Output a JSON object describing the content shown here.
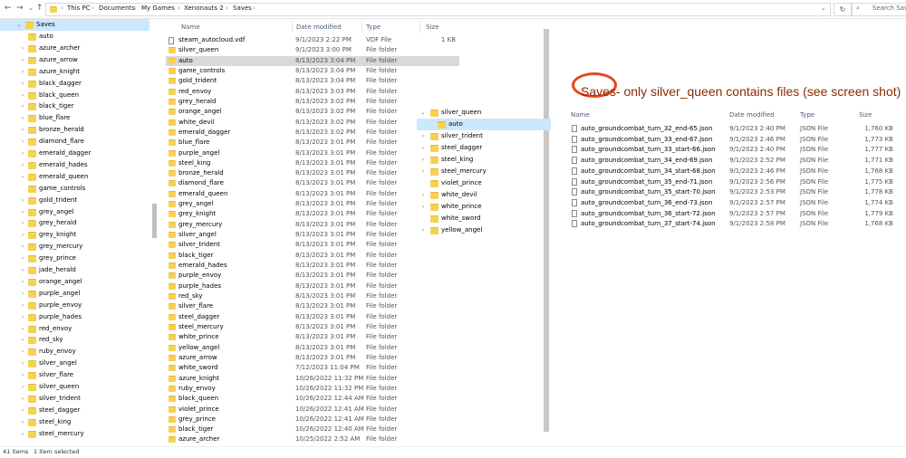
{
  "address_bar": {
    "crumbs": [
      "This PC",
      "Documents",
      "My Games",
      "Xenonauts 2",
      "Saves"
    ],
    "search_placeholder": "Search Saves"
  },
  "tree": {
    "selected": "Saves",
    "items": [
      "auto",
      "azure_archer",
      "azure_arrow",
      "azure_knight",
      "black_dagger",
      "black_queen",
      "black_tiger",
      "blue_flare",
      "bronze_herald",
      "diamond_flare",
      "emerald_dagger",
      "emerald_hades",
      "emerald_queen",
      "game_controls",
      "gold_trident",
      "grey_angel",
      "grey_herald",
      "grey_knight",
      "grey_mercury",
      "grey_prince",
      "jade_herald",
      "orange_angel",
      "purple_angel",
      "purple_envoy",
      "purple_hades",
      "red_envoy",
      "red_sky",
      "ruby_envoy",
      "silver_angel",
      "silver_flare",
      "silver_queen",
      "silver_trident",
      "steel_dagger",
      "steel_king",
      "steel_mercury"
    ]
  },
  "columns": {
    "name": "Name",
    "date": "Date modified",
    "type": "Type",
    "size": "Size"
  },
  "files": [
    {
      "name": "steam_autocloud.vdf",
      "date": "9/1/2023 2:22 PM",
      "type": "VDF File",
      "size": "1 KB",
      "kind": "file"
    },
    {
      "name": "silver_queen",
      "date": "9/1/2023 3:00 PM",
      "type": "File folder",
      "size": "",
      "kind": "folder"
    },
    {
      "name": "auto",
      "date": "8/13/2023 3:04 PM",
      "type": "File folder",
      "size": "",
      "kind": "folder",
      "selected": true
    },
    {
      "name": "game_controls",
      "date": "8/13/2023 3:04 PM",
      "type": "File folder",
      "size": "",
      "kind": "folder"
    },
    {
      "name": "gold_trident",
      "date": "8/13/2023 3:04 PM",
      "type": "File folder",
      "size": "",
      "kind": "folder"
    },
    {
      "name": "red_envoy",
      "date": "8/13/2023 3:03 PM",
      "type": "File folder",
      "size": "",
      "kind": "folder"
    },
    {
      "name": "grey_herald",
      "date": "8/13/2023 3:02 PM",
      "type": "File folder",
      "size": "",
      "kind": "folder"
    },
    {
      "name": "orange_angel",
      "date": "8/13/2023 3:02 PM",
      "type": "File folder",
      "size": "",
      "kind": "folder"
    },
    {
      "name": "white_devil",
      "date": "8/13/2023 3:02 PM",
      "type": "File folder",
      "size": "",
      "kind": "folder"
    },
    {
      "name": "emerald_dagger",
      "date": "8/13/2023 3:02 PM",
      "type": "File folder",
      "size": "",
      "kind": "folder"
    },
    {
      "name": "blue_flare",
      "date": "8/13/2023 3:01 PM",
      "type": "File folder",
      "size": "",
      "kind": "folder"
    },
    {
      "name": "purple_angel",
      "date": "8/13/2023 3:01 PM",
      "type": "File folder",
      "size": "",
      "kind": "folder"
    },
    {
      "name": "steel_king",
      "date": "8/13/2023 3:01 PM",
      "type": "File folder",
      "size": "",
      "kind": "folder"
    },
    {
      "name": "bronze_herald",
      "date": "8/13/2023 3:01 PM",
      "type": "File folder",
      "size": "",
      "kind": "folder"
    },
    {
      "name": "diamond_flare",
      "date": "8/13/2023 3:01 PM",
      "type": "File folder",
      "size": "",
      "kind": "folder"
    },
    {
      "name": "emerald_queen",
      "date": "8/13/2023 3:01 PM",
      "type": "File folder",
      "size": "",
      "kind": "folder"
    },
    {
      "name": "grey_angel",
      "date": "8/13/2023 3:01 PM",
      "type": "File folder",
      "size": "",
      "kind": "folder"
    },
    {
      "name": "grey_knight",
      "date": "8/13/2023 3:01 PM",
      "type": "File folder",
      "size": "",
      "kind": "folder"
    },
    {
      "name": "grey_mercury",
      "date": "8/13/2023 3:01 PM",
      "type": "File folder",
      "size": "",
      "kind": "folder"
    },
    {
      "name": "silver_angel",
      "date": "8/13/2023 3:01 PM",
      "type": "File folder",
      "size": "",
      "kind": "folder"
    },
    {
      "name": "silver_trident",
      "date": "8/13/2023 3:01 PM",
      "type": "File folder",
      "size": "",
      "kind": "folder"
    },
    {
      "name": "black_tiger",
      "date": "8/13/2023 3:01 PM",
      "type": "File folder",
      "size": "",
      "kind": "folder"
    },
    {
      "name": "emerald_hades",
      "date": "8/13/2023 3:01 PM",
      "type": "File folder",
      "size": "",
      "kind": "folder"
    },
    {
      "name": "purple_envoy",
      "date": "8/13/2023 3:01 PM",
      "type": "File folder",
      "size": "",
      "kind": "folder"
    },
    {
      "name": "purple_hades",
      "date": "8/13/2023 3:01 PM",
      "type": "File folder",
      "size": "",
      "kind": "folder"
    },
    {
      "name": "red_sky",
      "date": "8/13/2023 3:01 PM",
      "type": "File folder",
      "size": "",
      "kind": "folder"
    },
    {
      "name": "silver_flare",
      "date": "8/13/2023 3:01 PM",
      "type": "File folder",
      "size": "",
      "kind": "folder"
    },
    {
      "name": "steel_dagger",
      "date": "8/13/2023 3:01 PM",
      "type": "File folder",
      "size": "",
      "kind": "folder"
    },
    {
      "name": "steel_mercury",
      "date": "8/13/2023 3:01 PM",
      "type": "File folder",
      "size": "",
      "kind": "folder"
    },
    {
      "name": "white_prince",
      "date": "8/13/2023 3:01 PM",
      "type": "File folder",
      "size": "",
      "kind": "folder"
    },
    {
      "name": "yellow_angel",
      "date": "8/13/2023 3:01 PM",
      "type": "File folder",
      "size": "",
      "kind": "folder"
    },
    {
      "name": "azure_arrow",
      "date": "8/13/2023 3:01 PM",
      "type": "File folder",
      "size": "",
      "kind": "folder"
    },
    {
      "name": "white_sword",
      "date": "7/12/2023 11:04 PM",
      "type": "File folder",
      "size": "",
      "kind": "folder"
    },
    {
      "name": "azure_knight",
      "date": "10/26/2022 11:32 PM",
      "type": "File folder",
      "size": "",
      "kind": "folder"
    },
    {
      "name": "ruby_envoy",
      "date": "10/26/2022 11:32 PM",
      "type": "File folder",
      "size": "",
      "kind": "folder"
    },
    {
      "name": "black_queen",
      "date": "10/26/2022 12:44 AM",
      "type": "File folder",
      "size": "",
      "kind": "folder"
    },
    {
      "name": "violet_prince",
      "date": "10/26/2022 12:41 AM",
      "type": "File folder",
      "size": "",
      "kind": "folder"
    },
    {
      "name": "grey_prince",
      "date": "10/26/2022 12:41 AM",
      "type": "File folder",
      "size": "",
      "kind": "folder"
    },
    {
      "name": "black_tiger",
      "date": "10/26/2022 12:40 AM",
      "type": "File folder",
      "size": "",
      "kind": "folder"
    },
    {
      "name": "azure_archer",
      "date": "10/25/2022 2:52 AM",
      "type": "File folder",
      "size": "",
      "kind": "folder"
    }
  ],
  "status": {
    "count": "41 items",
    "selected": "1 item selected"
  },
  "inset_tree": [
    {
      "label": "silver_queen",
      "expanded": true,
      "indent": 0
    },
    {
      "label": "auto",
      "expanded": false,
      "indent": 1,
      "selected": true
    },
    {
      "label": "silver_trident",
      "expanded": false,
      "indent": 0
    },
    {
      "label": "steel_dagger",
      "expanded": false,
      "indent": 0
    },
    {
      "label": "steel_king",
      "expanded": false,
      "indent": 0
    },
    {
      "label": "steel_mercury",
      "expanded": false,
      "indent": 0
    },
    {
      "label": "violet_prince",
      "expanded": false,
      "indent": 0,
      "nochev": true
    },
    {
      "label": "white_devil",
      "expanded": false,
      "indent": 0
    },
    {
      "label": "white_prince",
      "expanded": false,
      "indent": 0
    },
    {
      "label": "white_sword",
      "expanded": false,
      "indent": 0,
      "nochev": true
    },
    {
      "label": "yellow_angel",
      "expanded": false,
      "indent": 0
    }
  ],
  "note": "Saves- only silver_queen contains files (see screen shot)",
  "right_pane": {
    "columns": {
      "name": "Name",
      "date": "Date modified",
      "type": "Type",
      "size": "Size"
    },
    "files": [
      {
        "name": "auto_groundcombat_turn_32_end-65.json",
        "date": "9/1/2023 2:40 PM",
        "type": "JSON File",
        "size": "1,760 KB"
      },
      {
        "name": "auto_groundcombat_turn_33_end-67.json",
        "date": "9/1/2023 2:46 PM",
        "type": "JSON File",
        "size": "1,773 KB"
      },
      {
        "name": "auto_groundcombat_turn_33_start-66.json",
        "date": "9/1/2023 2:40 PM",
        "type": "JSON File",
        "size": "1,777 KB"
      },
      {
        "name": "auto_groundcombat_turn_34_end-69.json",
        "date": "9/1/2023 2:52 PM",
        "type": "JSON File",
        "size": "1,771 KB"
      },
      {
        "name": "auto_groundcombat_turn_34_start-68.json",
        "date": "9/1/2023 2:46 PM",
        "type": "JSON File",
        "size": "1,768 KB"
      },
      {
        "name": "auto_groundcombat_turn_35_end-71.json",
        "date": "9/1/2023 2:56 PM",
        "type": "JSON File",
        "size": "1,775 KB"
      },
      {
        "name": "auto_groundcombat_turn_35_start-70.json",
        "date": "9/1/2023 2:53 PM",
        "type": "JSON File",
        "size": "1,778 KB"
      },
      {
        "name": "auto_groundcombat_turn_36_end-73.json",
        "date": "9/1/2023 2:57 PM",
        "type": "JSON File",
        "size": "1,774 KB"
      },
      {
        "name": "auto_groundcombat_turn_36_start-72.json",
        "date": "9/1/2023 2:57 PM",
        "type": "JSON File",
        "size": "1,779 KB"
      },
      {
        "name": "auto_groundcombat_turn_37_start-74.json",
        "date": "9/1/2023 2:58 PM",
        "type": "JSON File",
        "size": "1,768 KB"
      }
    ]
  },
  "colors": {
    "selection": "#cce8ff",
    "folder": "#f7d154",
    "annotation": "#e8461d"
  }
}
